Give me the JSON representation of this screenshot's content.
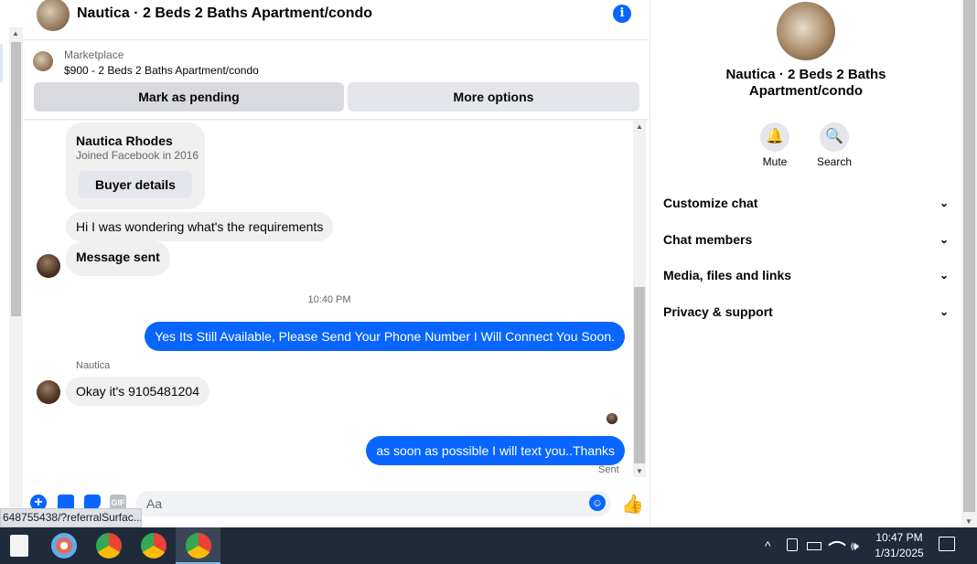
{
  "header": {
    "title": "Nautica · 2 Beds 2 Baths Apartment/condo",
    "info_icon": "i"
  },
  "marketplace": {
    "label": "Marketplace",
    "price_line": "$900 - 2 Beds 2 Baths Apartment/condo",
    "pending_label": "Mark as pending",
    "more_label": "More options"
  },
  "profile_card": {
    "name": "Nautica Rhodes",
    "joined": "Joined Facebook in 2016",
    "buyer_button": "Buyer details"
  },
  "messages": {
    "m1": "Hi I was wondering what's the requirements",
    "m2": "Message sent",
    "timestamp": "10:40 PM",
    "m3": "Yes Its Still Available, Please Send Your Phone Number I Will Connect You Soon.",
    "sender_name": "Nautica",
    "m4": "Okay it's 9105481204",
    "m5": "as soon as possible I will text you..Thanks",
    "status": "Sent"
  },
  "composer": {
    "placeholder": "Aa",
    "plus": "+",
    "gif": "GIF",
    "emoji": "☺",
    "like": "👍"
  },
  "url_tip": "648755438/?referralSurfac...",
  "right_panel": {
    "title": "Nautica · 2 Beds 2 Baths Apartment/condo",
    "mute_label": "Mute",
    "search_label": "Search",
    "mute_icon": "🔔",
    "search_icon": "🔍",
    "rows": {
      "customize": "Customize chat",
      "members": "Chat members",
      "media": "Media, files and links",
      "privacy": "Privacy & support"
    },
    "chevron": "⌄"
  },
  "taskbar": {
    "time": "10:47 PM",
    "date": "1/31/2025",
    "tray_up": "^",
    "volume": "🕪"
  }
}
